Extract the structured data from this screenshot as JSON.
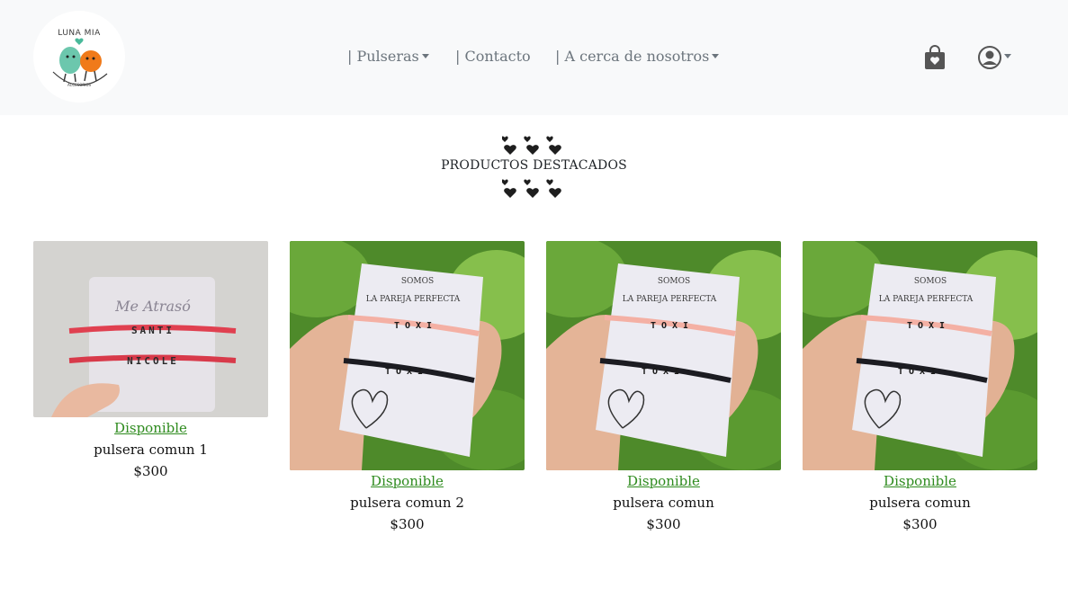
{
  "brand": {
    "name": "LUNA MIA",
    "tagline": "ACCESORIOS"
  },
  "nav": {
    "items": [
      {
        "label": "| Pulseras",
        "has_dropdown": true
      },
      {
        "label": "| Contacto",
        "has_dropdown": false
      },
      {
        "label": "| A cerca de nosotros",
        "has_dropdown": true
      }
    ],
    "icons": [
      "shopping-bag-heart-icon",
      "user-circle-icon"
    ]
  },
  "featured": {
    "title": "PRODUCTOS DESTACADOS"
  },
  "products": [
    {
      "status": "Disponible",
      "name": "pulsera comun 1",
      "price": "$300",
      "card_text": [
        "Me Atrasó"
      ],
      "bead_text": [
        "SANTI",
        "NICOLE"
      ]
    },
    {
      "status": "Disponible",
      "name": "pulsera comun 2",
      "price": "$300",
      "card_text": [
        "SOMOS",
        "LA PAREJA PERFECTA"
      ],
      "bead_text": [
        "TOXI",
        "TOXI"
      ]
    },
    {
      "status": "Disponible",
      "name": "pulsera comun",
      "price": "$300",
      "card_text": [
        "SOMOS",
        "LA PAREJA PERFECTA"
      ],
      "bead_text": [
        "TOXI",
        "TOXI"
      ]
    },
    {
      "status": "Disponible",
      "name": "pulsera comun",
      "price": "$300",
      "card_text": [
        "SOMOS",
        "LA PAREJA PERFECTA"
      ],
      "bead_text": [
        "TOXI",
        "TOXI"
      ]
    }
  ],
  "colors": {
    "navbar_bg": "#f8f9fa",
    "nav_text": "#6c757d",
    "status_green": "#2e8b1e"
  }
}
